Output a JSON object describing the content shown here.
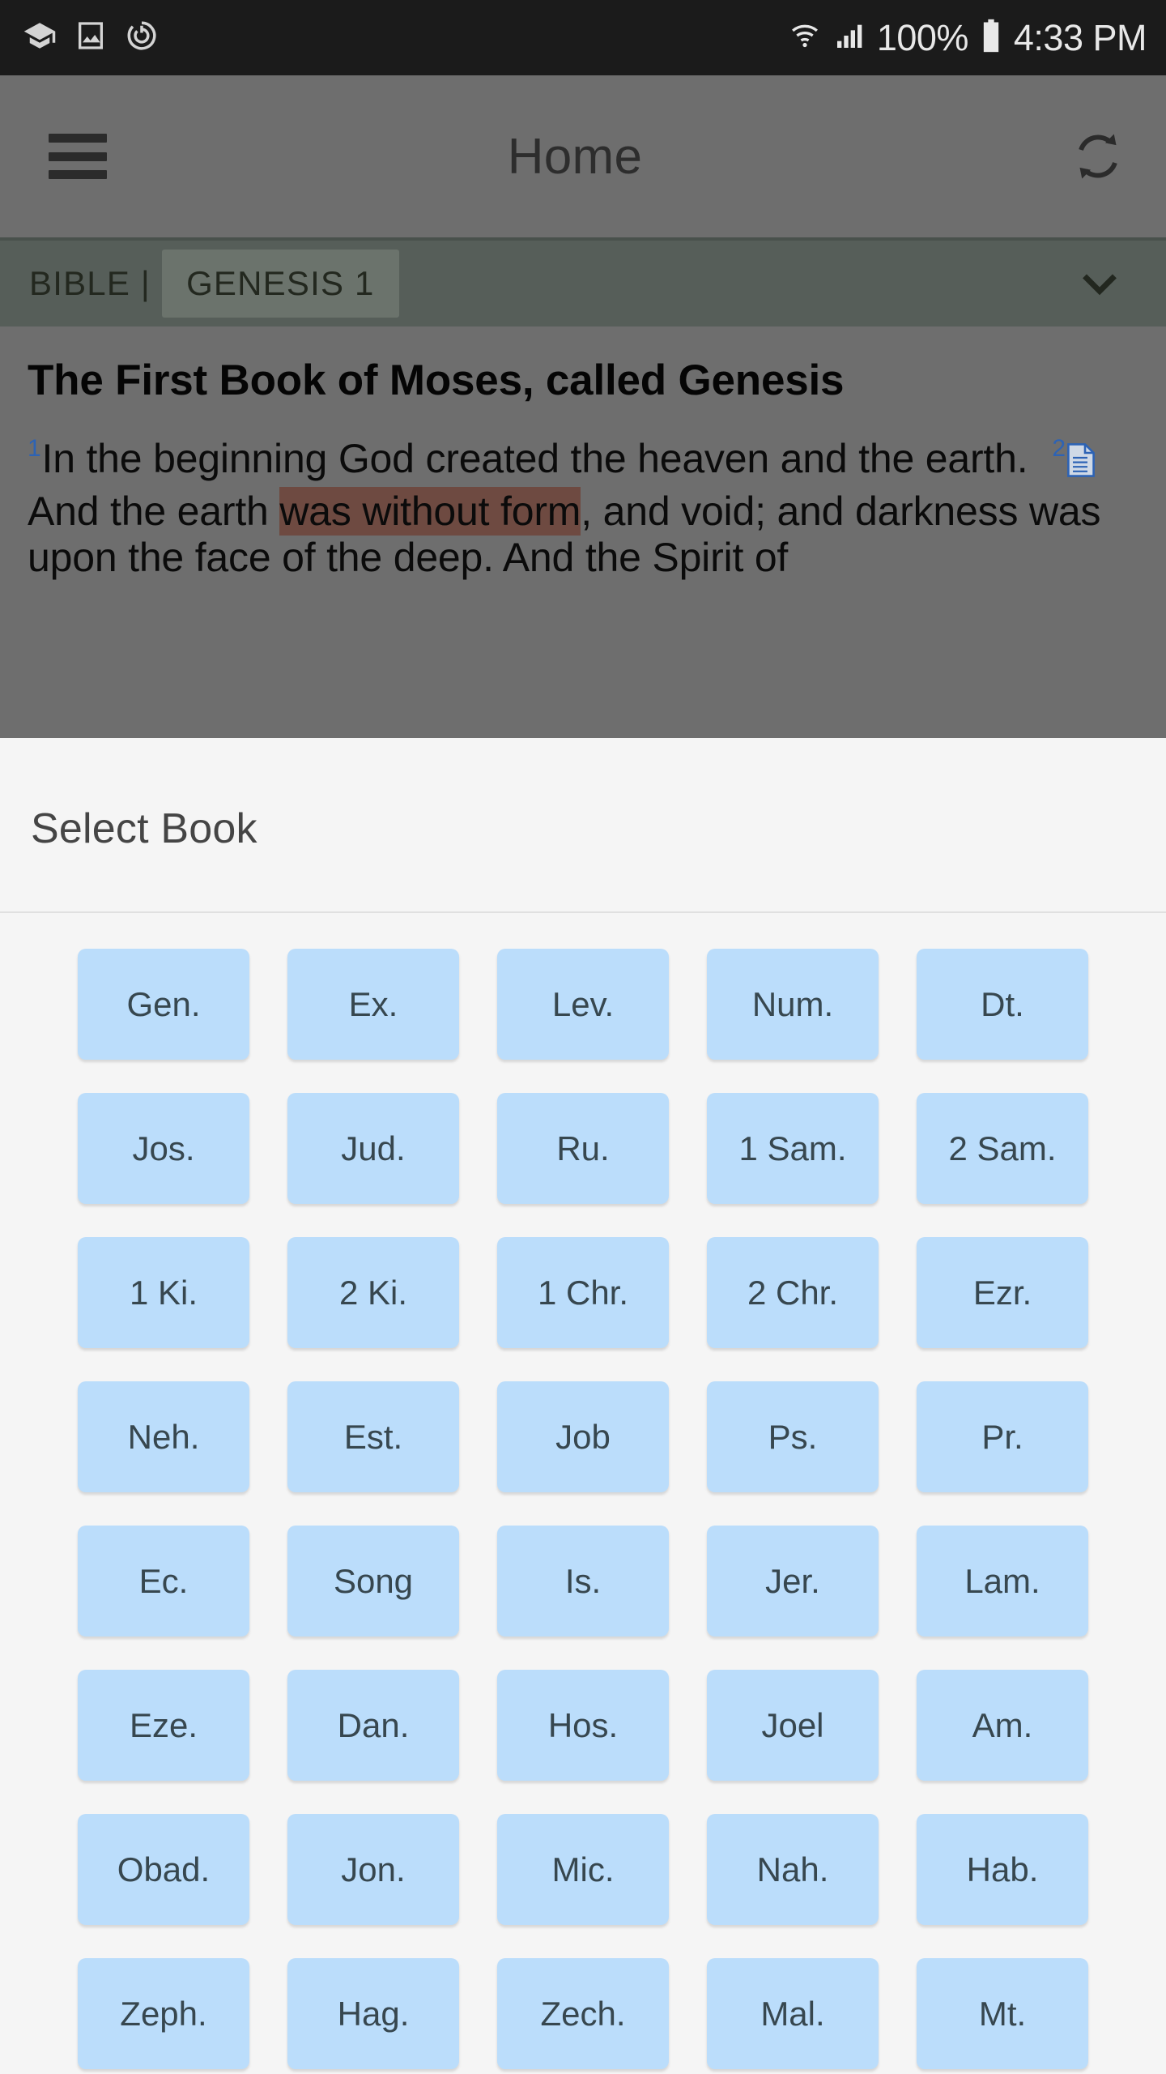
{
  "status_bar": {
    "left_icons": [
      "graduation-cap-icon",
      "image-icon",
      "sync-status-icon"
    ],
    "wifi_icon": "wifi-icon",
    "signal_icon": "cellular-signal-icon",
    "battery_percent": "100%",
    "battery_icon": "battery-full-icon",
    "time": "4:33 PM",
    "background_color": "#1b1b1b",
    "foreground_color": "#e8e8e8"
  },
  "app_bar": {
    "menu_icon": "hamburger-menu-icon",
    "title": "Home",
    "action_icon": "sync-refresh-icon",
    "background_color": "#6e6e6e"
  },
  "bible_bar": {
    "label": "BIBLE |",
    "chapter": "GENESIS 1",
    "expand_icon": "chevron-down-icon",
    "background_color": "#565e59",
    "chip_color": "#6b736c"
  },
  "scripture": {
    "heading": "The First Book of Moses, called Genesis",
    "verse_1_num": "1",
    "verse_1_text": "In the beginning God created the heaven and the earth.",
    "verse_2_num": "2",
    "verse_2_note_icon": "note-document-icon",
    "verse_2_part_a": "And the earth ",
    "verse_2_highlight": "was without form",
    "verse_2_part_b": ", and void; and darkness was upon the face of the deep. And the Spirit of",
    "verse_number_color": "#2d63b5",
    "highlight_color": "#6e4a41"
  },
  "sheet": {
    "title": "Select Book",
    "background_color": "#f5f5f5",
    "button_color": "#bbddfb",
    "button_text_color": "#37474f",
    "book_rows": [
      [
        "Gen.",
        "Ex.",
        "Lev.",
        "Num.",
        "Dt."
      ],
      [
        "Jos.",
        "Jud.",
        "Ru.",
        "1 Sam.",
        "2 Sam."
      ],
      [
        "1 Ki.",
        "2 Ki.",
        "1 Chr.",
        "2 Chr.",
        "Ezr."
      ],
      [
        "Neh.",
        "Est.",
        "Job",
        "Ps.",
        "Pr."
      ],
      [
        "Ec.",
        "Song",
        "Is.",
        "Jer.",
        "Lam."
      ],
      [
        "Eze.",
        "Dan.",
        "Hos.",
        "Joel",
        "Am."
      ],
      [
        "Obad.",
        "Jon.",
        "Mic.",
        "Nah.",
        "Hab."
      ],
      [
        "Zeph.",
        "Hag.",
        "Zech.",
        "Mal.",
        "Mt."
      ]
    ]
  }
}
